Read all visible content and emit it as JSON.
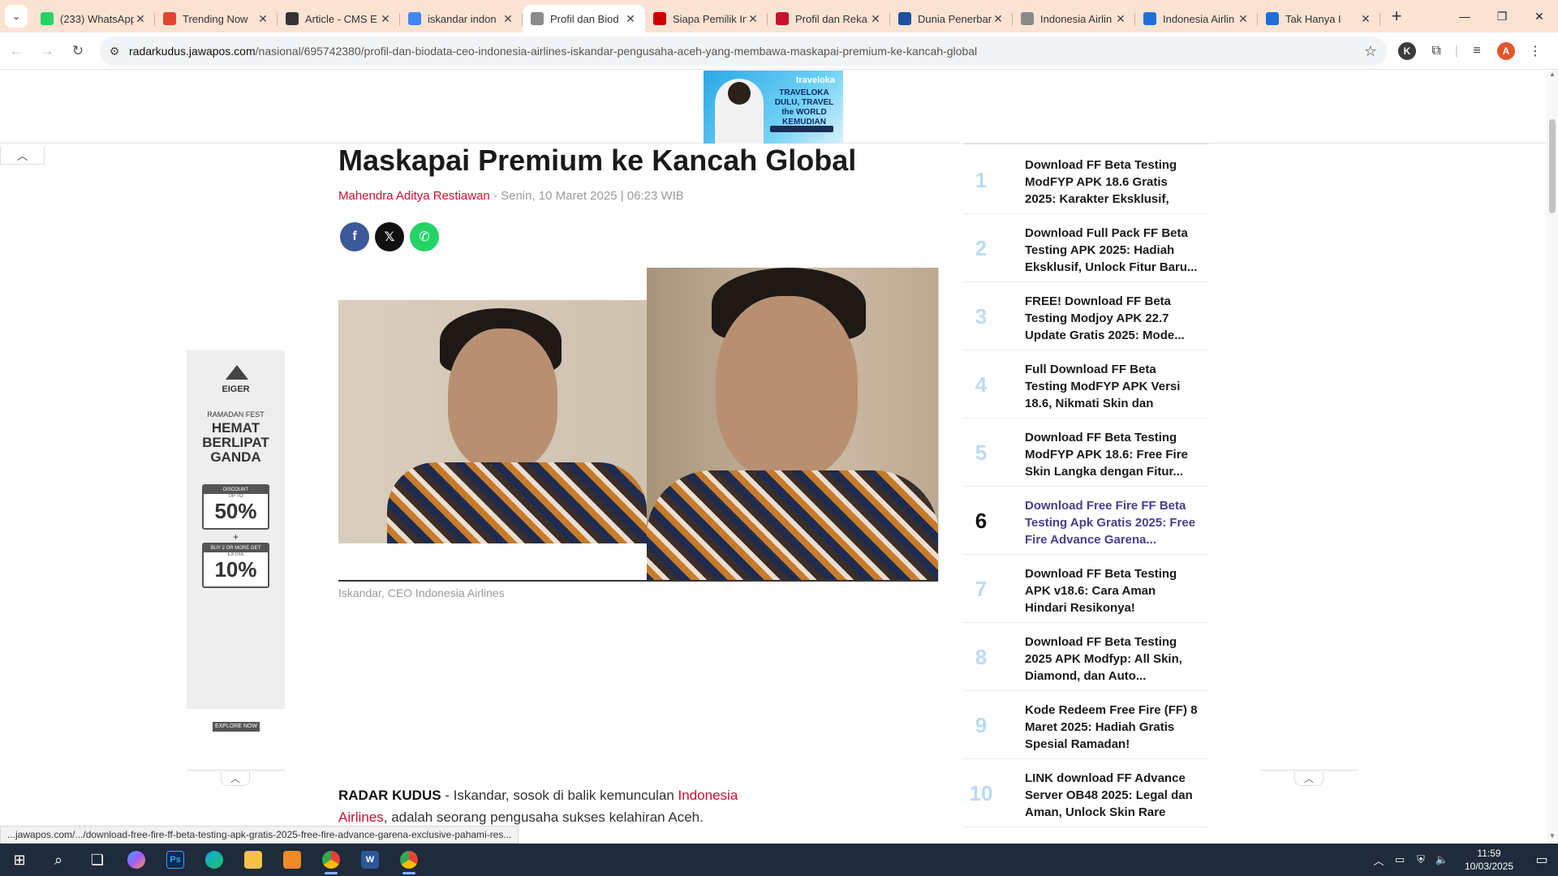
{
  "browser": {
    "tabs": [
      {
        "title": "(233) WhatsApp",
        "fav_color": "#25d366",
        "icon": "whatsapp-icon",
        "active": false
      },
      {
        "title": "Trending Now",
        "fav_color": "#e0442f",
        "icon": "trending-icon",
        "active": false
      },
      {
        "title": "Article - CMS E",
        "fav_color": "#333333",
        "icon": "cms-icon",
        "active": false
      },
      {
        "title": "iskandar indon",
        "fav_color": "#4285f4",
        "icon": "google-icon",
        "active": false
      },
      {
        "title": "Profil dan Biod",
        "fav_color": "#8a8a8a",
        "icon": "radar-icon",
        "active": true
      },
      {
        "title": "Siapa Pemilik In",
        "fav_color": "#cc0000",
        "icon": "cnn-icon",
        "active": false
      },
      {
        "title": "Profil dan Reka",
        "fav_color": "#c8102e",
        "icon": "viva-icon",
        "active": false
      },
      {
        "title": "Dunia Penerban",
        "fav_color": "#1e4fa0",
        "icon": "news-icon",
        "active": false
      },
      {
        "title": "Indonesia Airlin",
        "fav_color": "#8a8a8a",
        "icon": "page-icon",
        "active": false
      },
      {
        "title": "Indonesia Airlin",
        "fav_color": "#1e6fd9",
        "icon": "globe-icon",
        "active": false
      },
      {
        "title": "Tak Hanya I",
        "fav_color": "#1e6fd9",
        "icon": "news-icon",
        "active": false
      }
    ],
    "url_host": "radarkudus.jawapos.com",
    "url_path": "/nasional/695742380/profil-dan-biodata-ceo-indonesia-airlines-iskandar-pengusaha-aceh-yang-membawa-maskapai-premium-ke-kancah-global",
    "profile_k": "K",
    "profile_a": "A",
    "status_url": "...jawapos.com/.../download-free-fire-ff-beta-testing-apk-gratis-2025-free-fire-advance-garena-exclusive-pahami-res..."
  },
  "ad_top": {
    "brand": "traveloka",
    "slogan": "TRAVELOKA DULU, TRAVEL the WORLD KEMUDIAN"
  },
  "ad_side": {
    "logo": "EIGER",
    "fest": "RAMADAN FEST",
    "headline_1": "HEMAT",
    "headline_2": "BERLIPAT",
    "headline_3": "GANDA",
    "discount_label": "DISCOUNT",
    "discount_upto": "UP TO",
    "discount_value": "50%",
    "plus": "+",
    "extra_label": "BUY 2 OR MORE GET",
    "extra_sub": "EXTRA",
    "extra_value": "10%",
    "cta": "EXPLORE NOW"
  },
  "article": {
    "headline": "Maskapai Premium ke Kancah Global",
    "author": "Mahendra Aditya Restiawan",
    "date": " - Senin, 10 Maret 2025 | 06:23 WIB",
    "caption": "Iskandar, CEO Indonesia Airlines",
    "lead_kicker": "RADAR KUDUS",
    "lead_dash": " - Iskandar, sosok di balik kemunculan ",
    "lead_link": "Indonesia Airlines",
    "lead_rest": ", adalah seorang pengusaha sukses kelahiran Aceh."
  },
  "trending": [
    {
      "num": "1",
      "title": "Download FF Beta Testing ModFYP APK 18.6 Gratis 2025: Karakter Eksklusif, Unlock Al..."
    },
    {
      "num": "2",
      "title": "Download Full Pack FF Beta Testing APK 2025: Hadiah Eksklusif, Unlock Fitur Baru..."
    },
    {
      "num": "3",
      "title": "FREE! Download FF Beta Testing Modjoy APK 22.7 Update Gratis 2025: Mode..."
    },
    {
      "num": "4",
      "title": "Full Download FF Beta Testing ModFYP APK Versi 18.6, Nikmati Skin dan Senjata..."
    },
    {
      "num": "5",
      "title": "Download FF Beta Testing ModFYP APK 18.6: Free Fire Skin Langka dengan Fitur..."
    },
    {
      "num": "6",
      "title": "Download Free Fire FF Beta Testing Apk Gratis 2025: Free Fire Advance Garena..."
    },
    {
      "num": "7",
      "title": "Download FF Beta Testing APK v18.6: Cara Aman Hindari Resikonya!"
    },
    {
      "num": "8",
      "title": "Download FF Beta Testing 2025 APK Modfyp: All Skin, Diamond, dan Auto..."
    },
    {
      "num": "9",
      "title": "Kode Redeem Free Fire (FF) 8 Maret 2025: Hadiah Gratis Spesial Ramadan!"
    },
    {
      "num": "10",
      "title": "LINK download FF Advance Server OB48 2025: Legal dan Aman, Unlock Skin Rare dan..."
    }
  ],
  "taskbar": {
    "time": "11:59",
    "date": "10/03/2025"
  }
}
